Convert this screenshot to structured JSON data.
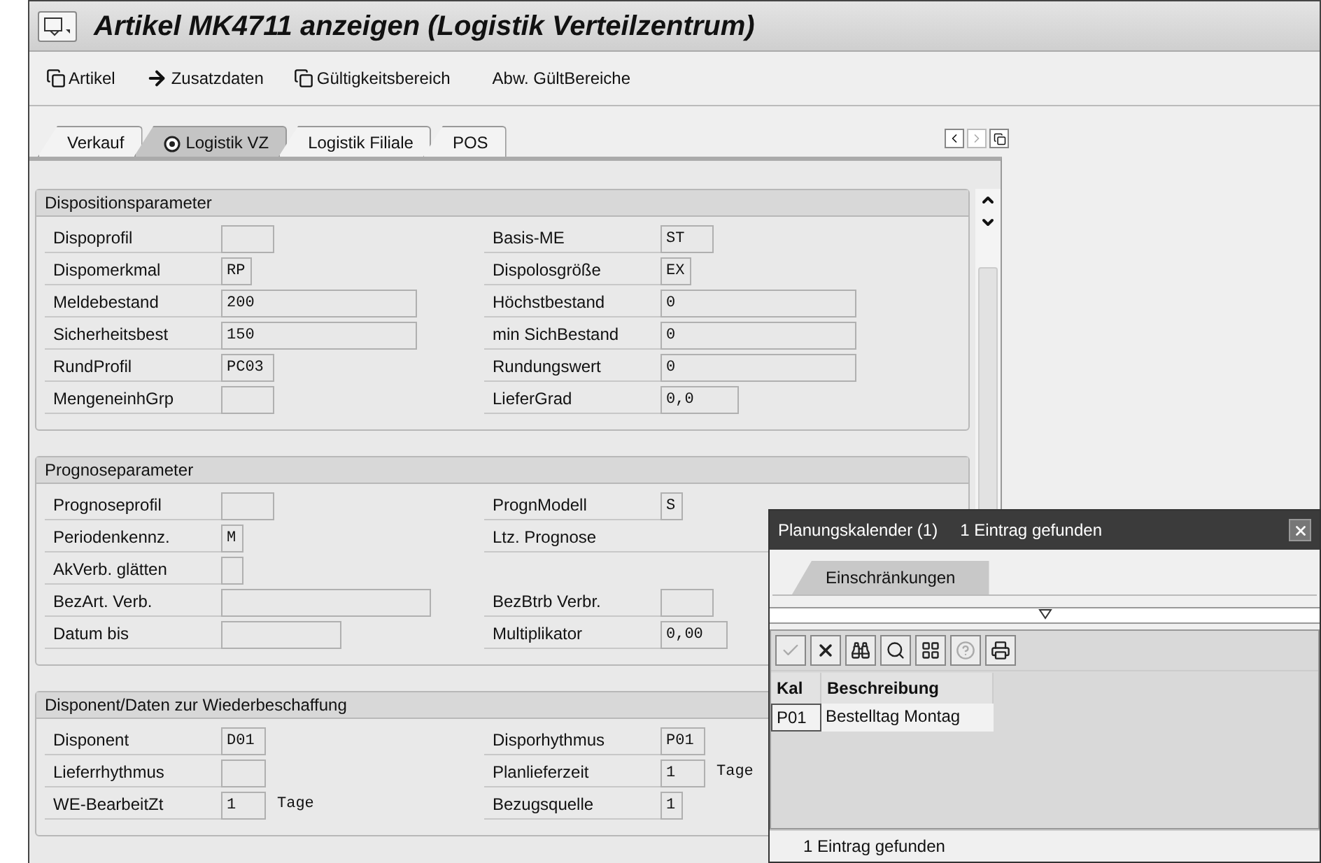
{
  "window": {
    "title": "Artikel MK4711 anzeigen (Logistik Verteilzentrum)"
  },
  "toolbar": [
    {
      "label": "Artikel",
      "kind": "windows"
    },
    {
      "label": "Zusatzdaten",
      "kind": "arrow"
    },
    {
      "label": "Gültigkeitsbereich",
      "kind": "windows"
    },
    {
      "label": "Abw. GültBereiche",
      "kind": "text"
    }
  ],
  "tabs": [
    {
      "label": "Verkauf",
      "selected": false
    },
    {
      "label": "Logistik VZ",
      "selected": true
    },
    {
      "label": "Logistik Filiale",
      "selected": false
    },
    {
      "label": "POS",
      "selected": false
    }
  ],
  "sections": [
    {
      "title": "Dispositionsparameter",
      "rows": [
        {
          "left": {
            "label": "Dispoprofil",
            "kind": "c4"
          },
          "right": {
            "label": "Basis-ME",
            "value": "ST",
            "kind": "c4"
          }
        },
        {
          "left": {
            "label": "Dispomerkmal",
            "value": "RP",
            "kind": "c2"
          },
          "right": {
            "label": "Dispolosgröße",
            "value": "EX",
            "kind": "c2"
          }
        },
        {
          "left": {
            "label": "Meldebestand",
            "value": "200",
            "kind": "long"
          },
          "right": {
            "label": "Höchstbestand",
            "value": "0",
            "kind": "long"
          }
        },
        {
          "left": {
            "label": "Sicherheitsbest",
            "value": "150",
            "kind": "long"
          },
          "right": {
            "label": "min SichBestand",
            "value": "0",
            "kind": "long"
          }
        },
        {
          "left": {
            "label": "RundProfil",
            "value": "PC03",
            "kind": "c4"
          },
          "right": {
            "label": "Rundungswert",
            "value": "0",
            "kind": "long"
          }
        },
        {
          "left": {
            "label": "MengeneinhGrp",
            "kind": "c4"
          },
          "right": {
            "label": "LieferGrad",
            "value": "0,0",
            "kind": "c6"
          }
        }
      ]
    },
    {
      "title": "Prognoseparameter",
      "rows": [
        {
          "left": {
            "label": "Prognoseprofil",
            "kind": "c4"
          },
          "right": {
            "label": "PrognModell",
            "value": "S",
            "kind": "c1"
          }
        },
        {
          "left": {
            "label": "Periodenkennz.",
            "value": "M",
            "kind": "c1"
          },
          "right": {
            "label": "Ltz. Prognose",
            "kind": "none"
          }
        },
        {
          "left": {
            "label": "AkVerb. glätten",
            "kind": "c1"
          }
        },
        {
          "left": {
            "label": "BezArt. Verb.",
            "kind": "wide"
          },
          "right": {
            "label": "BezBtrb Verbr.",
            "kind": "c4"
          }
        },
        {
          "left": {
            "label": "Datum bis",
            "kind": "c10"
          },
          "right": {
            "label": "Multiplikator",
            "value": "0,00",
            "kind": "c5"
          }
        }
      ]
    },
    {
      "title": "Disponent/Daten zur Wiederbeschaffung",
      "rows": [
        {
          "left": {
            "label": "Disponent",
            "value": "D01",
            "kind": "c3"
          },
          "right": {
            "label": "Disporhythmus",
            "value": "P01",
            "kind": "c3"
          }
        },
        {
          "left": {
            "label": "Lieferrhythmus",
            "kind": "c3"
          },
          "right": {
            "label": "Planlieferzeit",
            "value": "1",
            "kind": "c3",
            "unit": "Tage"
          }
        },
        {
          "left": {
            "label": "WE-BearbeitZt",
            "value": "1",
            "kind": "c3",
            "unit": "Tage"
          },
          "right": {
            "label": "Bezugsquelle",
            "value": "1",
            "kind": "c1"
          }
        }
      ]
    }
  ],
  "popup": {
    "title": "Planungskalender (1)",
    "subtitle": "1 Eintrag gefunden",
    "tab": "Einschränkungen",
    "toolbar": [
      {
        "kind": "check",
        "disabled": true
      },
      {
        "kind": "cancel",
        "disabled": false
      },
      {
        "kind": "find",
        "disabled": false
      },
      {
        "kind": "find-next",
        "disabled": false
      },
      {
        "kind": "layout",
        "disabled": false
      },
      {
        "kind": "help",
        "disabled": true
      },
      {
        "kind": "print",
        "disabled": false
      }
    ],
    "table": {
      "columns": [
        "Kal",
        "Beschreibung"
      ],
      "rows": [
        [
          "P01",
          "Bestelltag Montag"
        ]
      ]
    },
    "status": "1 Eintrag gefunden"
  }
}
